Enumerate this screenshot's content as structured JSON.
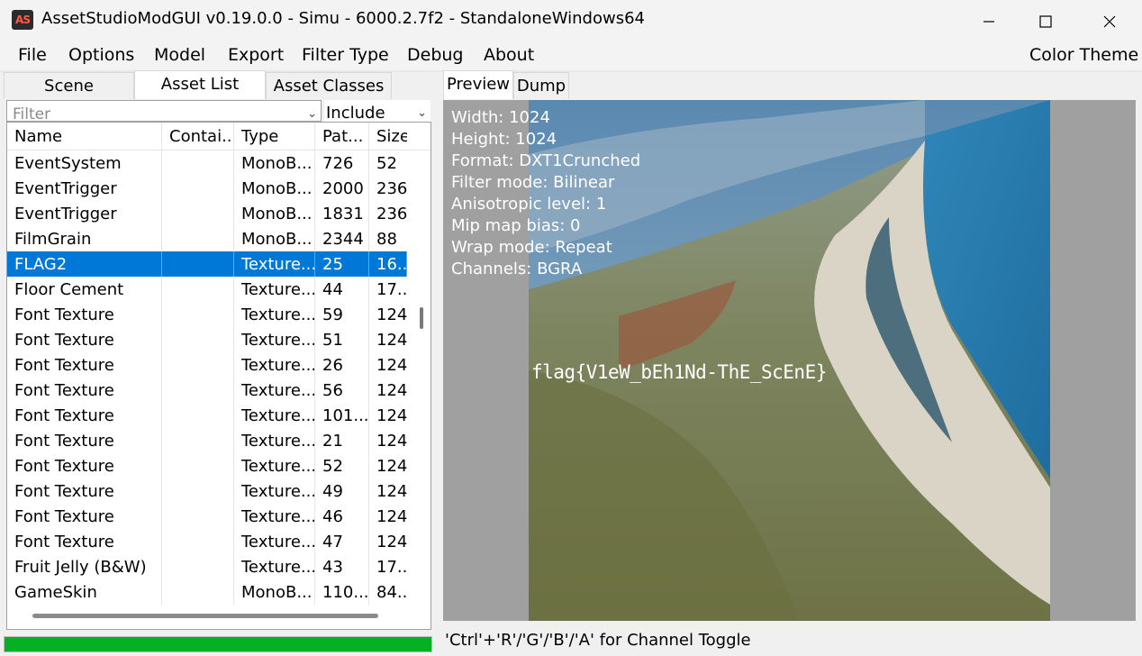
{
  "window": {
    "title": "AssetStudioModGUI v0.19.0.0 - Simu - 6000.2.7f2 - StandaloneWindows64",
    "icon_text": "AS",
    "minimize_icon": "minimize-icon",
    "maximize_icon": "maximize-icon",
    "close_icon": "close-icon"
  },
  "menu": {
    "items": [
      "File",
      "Options",
      "Model",
      "Export",
      "Filter Type",
      "Debug",
      "About"
    ],
    "color_theme": "Color Theme"
  },
  "left": {
    "tabs": [
      "Scene Hierarchy",
      "Asset List",
      "Asset Classes"
    ],
    "active_tab": "Asset List",
    "filter_placeholder": "Filter",
    "include_value": "Include",
    "columns": [
      "Name",
      "Contai...",
      "Type",
      "Pat...",
      "Size"
    ],
    "rows": [
      {
        "name": "EventSystem",
        "container": "",
        "type": "MonoB...",
        "path": "726",
        "size": "52"
      },
      {
        "name": "EventTrigger",
        "container": "",
        "type": "MonoB...",
        "path": "2000",
        "size": "236"
      },
      {
        "name": "EventTrigger",
        "container": "",
        "type": "MonoB...",
        "path": "1831",
        "size": "236"
      },
      {
        "name": "FilmGrain",
        "container": "",
        "type": "MonoB...",
        "path": "2344",
        "size": "88"
      },
      {
        "name": "FLAG2",
        "container": "",
        "type": "Texture...",
        "path": "25",
        "size": "16...",
        "selected": true
      },
      {
        "name": "Floor Cement",
        "container": "",
        "type": "Texture...",
        "path": "44",
        "size": "17..."
      },
      {
        "name": "Font Texture",
        "container": "",
        "type": "Texture...",
        "path": "59",
        "size": "124"
      },
      {
        "name": "Font Texture",
        "container": "",
        "type": "Texture...",
        "path": "51",
        "size": "124"
      },
      {
        "name": "Font Texture",
        "container": "",
        "type": "Texture...",
        "path": "26",
        "size": "124"
      },
      {
        "name": "Font Texture",
        "container": "",
        "type": "Texture...",
        "path": "56",
        "size": "124"
      },
      {
        "name": "Font Texture",
        "container": "",
        "type": "Texture...",
        "path": "101...",
        "size": "124"
      },
      {
        "name": "Font Texture",
        "container": "",
        "type": "Texture...",
        "path": "21",
        "size": "124"
      },
      {
        "name": "Font Texture",
        "container": "",
        "type": "Texture...",
        "path": "52",
        "size": "124"
      },
      {
        "name": "Font Texture",
        "container": "",
        "type": "Texture...",
        "path": "49",
        "size": "124"
      },
      {
        "name": "Font Texture",
        "container": "",
        "type": "Texture...",
        "path": "46",
        "size": "124"
      },
      {
        "name": "Font Texture",
        "container": "",
        "type": "Texture...",
        "path": "47",
        "size": "124"
      },
      {
        "name": "Fruit Jelly (B&W)",
        "container": "",
        "type": "Texture...",
        "path": "43",
        "size": "17..."
      },
      {
        "name": "GameSkin",
        "container": "",
        "type": "MonoB...",
        "path": "110...",
        "size": "84..."
      }
    ],
    "progress": 1.0
  },
  "right": {
    "tabs": [
      "Preview",
      "Dump"
    ],
    "active_tab": "Preview",
    "info": [
      "Width: 1024",
      "Height: 1024",
      "Format: DXT1Crunched",
      "Filter mode: Bilinear",
      "Anisotropic level: 1",
      "Mip map bias: 0",
      "Wrap mode: Repeat",
      "Channels: BGRA"
    ],
    "flag_text": "flag{V1eW_bEh1Nd-ThE_ScEnE}",
    "status": "'Ctrl'+'R'/'G'/'B'/'A' for Channel Toggle"
  },
  "colors": {
    "selection": "#0078d7",
    "progress": "#06b025",
    "preview_bg": "#a0a0a0"
  }
}
